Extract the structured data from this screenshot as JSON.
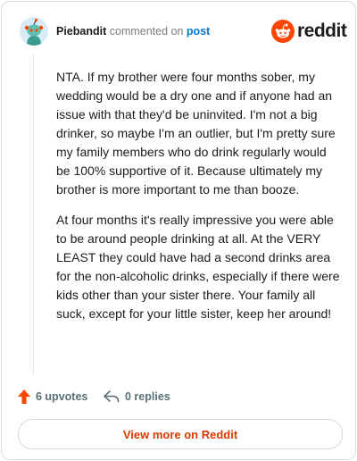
{
  "header": {
    "username": "Piebandit",
    "action_text": "commented on",
    "post_link": "post",
    "logo_text": "reddit",
    "avatar_icon": "snoo-avatar-icon",
    "logo_icon": "reddit-logo-icon"
  },
  "comment": {
    "paragraphs": [
      "NTA. If my brother were four months sober, my wedding would be a dry one and if anyone had an issue with that they'd be uninvited. I'm not a big drinker, so maybe I'm an outlier, but I'm pretty sure my family members who do drink regularly would be 100% supportive of it. Because ultimately my brother is more important to me than booze.",
      "At four months it's really impressive you were able to be around people drinking at all. At the VERY LEAST they could have had a second drinks area for the non-alcoholic drinks, especially if there were kids other than your sister there. Your family all suck, except for your little sister, keep her around!"
    ]
  },
  "actions": {
    "upvotes_label": "6 upvotes",
    "replies_label": "0 replies",
    "upvote_icon": "upvote-arrow-icon",
    "reply_icon": "reply-arrow-icon"
  },
  "footer": {
    "view_more_label": "View more on Reddit"
  },
  "colors": {
    "brand": "#ff4500",
    "link": "#0079d3",
    "view_more_text": "#d93a00",
    "muted": "#576f76"
  }
}
